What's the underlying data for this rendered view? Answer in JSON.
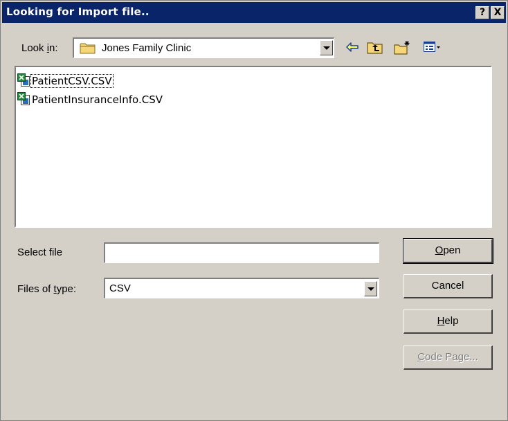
{
  "window": {
    "title": "Looking for Import file..",
    "help_glyph": "?",
    "close_glyph": "X"
  },
  "lookin": {
    "label_prefix": "Look ",
    "label_accel": "i",
    "label_suffix": "n:",
    "value": "Jones Family Clinic",
    "icon": "folder-icon"
  },
  "toolbar": {
    "icons": [
      "back-arrow-icon",
      "up-one-level-icon",
      "new-folder-icon",
      "view-menu-icon"
    ]
  },
  "files": [
    {
      "name": "PatientCSV.CSV",
      "icon": "excel-csv-file-icon"
    },
    {
      "name": "PatientInsuranceInfo.CSV",
      "icon": "excel-csv-file-icon"
    }
  ],
  "form": {
    "select_file_label": "Select file",
    "select_file_value": "",
    "files_of_type_prefix": "Files of ",
    "files_of_type_accel": "t",
    "files_of_type_suffix": "ype:",
    "files_of_type_value": "CSV"
  },
  "buttons": {
    "open": {
      "prefix": "",
      "accel": "O",
      "suffix": "pen"
    },
    "cancel": "Cancel",
    "help": {
      "prefix": "",
      "accel": "H",
      "suffix": "elp"
    },
    "code_page": {
      "prefix": "",
      "accel": "C",
      "suffix": "ode Page..."
    }
  }
}
